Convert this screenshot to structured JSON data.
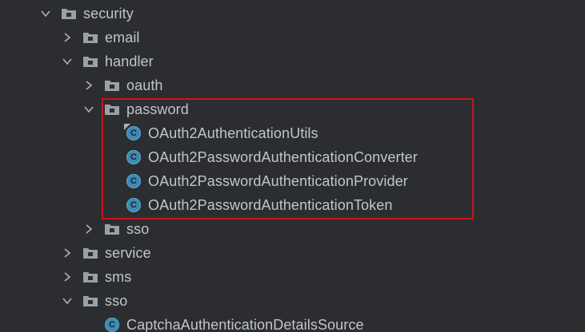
{
  "tree": {
    "security": {
      "label": "security",
      "state": "expanded",
      "icon": "folder-package-icon"
    },
    "email": {
      "label": "email",
      "state": "collapsed",
      "icon": "folder-package-icon"
    },
    "handler": {
      "label": "handler",
      "state": "expanded",
      "icon": "folder-package-icon"
    },
    "oauth": {
      "label": "oauth",
      "state": "collapsed",
      "icon": "folder-package-icon"
    },
    "password": {
      "label": "password",
      "state": "expanded",
      "icon": "folder-package-icon"
    },
    "classes": [
      {
        "label": "OAuth2AuthenticationUtils",
        "icon": "class-icon",
        "badge": "C"
      },
      {
        "label": "OAuth2PasswordAuthenticationConverter",
        "icon": "class-icon",
        "badge": "C"
      },
      {
        "label": "OAuth2PasswordAuthenticationProvider",
        "icon": "class-icon",
        "badge": "C"
      },
      {
        "label": "OAuth2PasswordAuthenticationToken",
        "icon": "class-icon",
        "badge": "C"
      }
    ],
    "sso_inner": {
      "label": "sso",
      "state": "collapsed",
      "icon": "folder-package-icon"
    },
    "service": {
      "label": "service",
      "state": "collapsed",
      "icon": "folder-package-icon"
    },
    "sms": {
      "label": "sms",
      "state": "collapsed",
      "icon": "folder-package-icon"
    },
    "sso": {
      "label": "sso",
      "state": "expanded",
      "icon": "folder-package-icon"
    },
    "captcha": {
      "label": "CaptchaAuthenticationDetailsSource",
      "icon": "class-icon",
      "badge": "C"
    }
  },
  "colors": {
    "background": "#2b2d30",
    "text": "#c1c5cb",
    "class_icon": "#3d8bb6",
    "highlight": "#c4161c"
  }
}
